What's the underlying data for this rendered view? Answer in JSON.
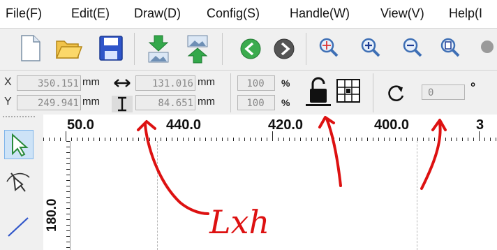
{
  "menu": [
    "File(F)",
    "Edit(E)",
    "Draw(D)",
    "Config(S)",
    "Handle(W)",
    "View(V)",
    "Help(I"
  ],
  "toolbar": {
    "icons": [
      "new-file-icon",
      "open-folder-icon",
      "save-icon",
      "import-icon",
      "export-icon",
      "back-arrow-icon",
      "forward-arrow-icon",
      "zoom-fit-icon",
      "zoom-in-icon",
      "zoom-out-icon",
      "zoom-page-icon"
    ]
  },
  "props": {
    "x_label": "X",
    "y_label": "Y",
    "x_value": "350.151",
    "y_value": "249.941",
    "x_unit": "mm",
    "y_unit": "mm",
    "width_value": "131.016",
    "height_value": "84.651",
    "width_unit": "mm",
    "height_unit": "mm",
    "scale_x": "100",
    "scale_y": "100",
    "pct_x": "%",
    "pct_y": "%",
    "rotate_value": "0",
    "degree": "°"
  },
  "ruler": {
    "top_labels": [
      "50.0",
      "440.0",
      "420.0",
      "400.0",
      "3"
    ],
    "left_label": "180.0"
  },
  "annotation": {
    "text": "Lxh"
  },
  "colors": {
    "annotation": "#dd1111",
    "toolbar_bg": "#f0f0f0",
    "field_bg": "#ececec"
  }
}
